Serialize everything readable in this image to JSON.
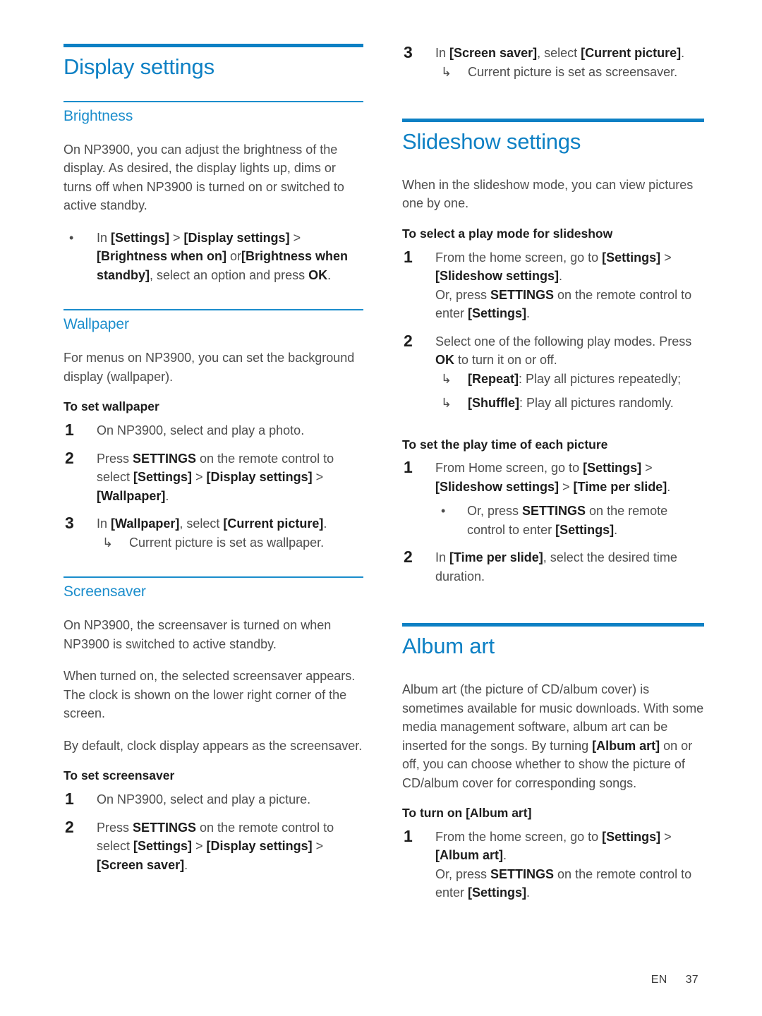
{
  "page": {
    "footer_lang": "EN",
    "footer_number": "37",
    "accent_color": "#0d80c4",
    "subheading_color": "#1b8dcc",
    "body_color": "#4d4d4d",
    "bold_color": "#1d1d1d"
  },
  "left_column": {
    "chapter_title": "Display settings",
    "brightness": {
      "heading": "Brightness",
      "intro": "On NP3900, you can adjust the brightness of the display. As desired, the display lights up, dims or turns off when NP3900 is turned on or switched to active standby.",
      "bullet": {
        "t1": "In ",
        "b1": "[Settings]",
        "t2": " > ",
        "b2": "[Display settings]",
        "t3": " > ",
        "b3": "[Brightness when on]",
        "t4": " or",
        "b4": "[Brightness when standby]",
        "t5": ", select an option and press ",
        "b5": "OK",
        "t6": "."
      }
    },
    "wallpaper": {
      "heading": "Wallpaper",
      "intro": "For menus on NP3900, you can set the background display (wallpaper).",
      "task_heading": "To set wallpaper",
      "step1": {
        "num": "1",
        "text": "On NP3900, select and play a photo."
      },
      "step2": {
        "num": "2",
        "t1": "Press ",
        "b1": "SETTINGS",
        "t2": " on the remote control to select ",
        "b2": "[Settings]",
        "t3": " > ",
        "b3": "[Display settings]",
        "t4": " > ",
        "b4": "[Wallpaper]",
        "t5": "."
      },
      "step3": {
        "num": "3",
        "t1": "In ",
        "b1": "[Wallpaper]",
        "t2": ", select ",
        "b2": "[Current picture]",
        "t3": ".",
        "arrow": "↳",
        "result": "Current picture is set as wallpaper."
      }
    },
    "screensaver": {
      "heading": "Screensaver",
      "para1": "On NP3900, the screensaver is turned on when NP3900 is switched to active standby.",
      "para2": "When turned on, the selected screensaver appears. The clock is shown on the lower right corner of the screen.",
      "para3": "By default, clock display appears as the screensaver.",
      "task_heading": "To set screensaver",
      "step1": {
        "num": "1",
        "text": "On NP3900, select and play a picture."
      },
      "step2": {
        "num": "2",
        "t1": "Press ",
        "b1": "SETTINGS",
        "t2": " on the remote control to select ",
        "b2": "[Settings]",
        "t3": " > ",
        "b3": "[Display settings]",
        "t4": " > ",
        "b4": "[Screen saver]",
        "t5": "."
      }
    }
  },
  "right_column": {
    "screensaver_step3": {
      "num": "3",
      "t1": "In ",
      "b1": "[Screen saver]",
      "t2": ", select ",
      "b2": "[Current picture]",
      "t3": ".",
      "arrow": "↳",
      "result": "Current picture is set as screensaver."
    },
    "slideshow": {
      "heading": "Slideshow settings",
      "intro": "When in the slideshow mode, you can view pictures one by one.",
      "task1_heading": "To select a play mode for slideshow",
      "task1_step1": {
        "num": "1",
        "t1": "From the home screen, go to ",
        "b1": "[Settings]",
        "t2": " > ",
        "b2": "[Slideshow settings]",
        "t3": ".",
        "t4": "Or, press ",
        "b3": "SETTINGS",
        "t5": " on the remote control to enter ",
        "b4": "[Settings]",
        "t6": "."
      },
      "task1_step2": {
        "num": "2",
        "t1": "Select one of the following play modes. Press ",
        "b1": "OK",
        "t2": " to turn it on or off.",
        "arrow": "↳",
        "repeat_bold": "[Repeat]",
        "repeat_text": ": Play all pictures repeatedly;",
        "shuffle_bold": "[Shuffle]",
        "shuffle_text": ": Play all pictures randomly."
      },
      "task2_heading": "To set the play time of each picture",
      "task2_step1": {
        "num": "1",
        "t1": "From Home screen, go to ",
        "b1": "[Settings]",
        "t2": " > ",
        "b2": "[Slideshow settings]",
        "t3": " > ",
        "b3": "[Time per slide]",
        "t4": ".",
        "dot_t1": "Or, press ",
        "dot_b1": "SETTINGS",
        "dot_t2": " on the remote control to enter ",
        "dot_b2": "[Settings]",
        "dot_t3": "."
      },
      "task2_step2": {
        "num": "2",
        "t1": "In ",
        "b1": "[Time per slide]",
        "t2": ", select the desired time duration."
      }
    },
    "album_art": {
      "heading": "Album art",
      "intro_t1": "Album art (the picture of CD/album cover) is sometimes available for music downloads. With some media management software, album art can be inserted for the songs. By turning ",
      "intro_b1": "[Album art]",
      "intro_t2": " on or off, you can choose whether to show the picture of CD/album cover for corresponding songs.",
      "task_heading": "To turn on [Album art]",
      "step1": {
        "num": "1",
        "t1": "From the home screen, go to ",
        "b1": "[Settings]",
        "t2": " > ",
        "b2": "[Album art]",
        "t3": ".",
        "t4": "Or, press ",
        "b3": "SETTINGS",
        "t5": " on the remote control to enter ",
        "b4": "[Settings]",
        "t6": "."
      }
    }
  }
}
